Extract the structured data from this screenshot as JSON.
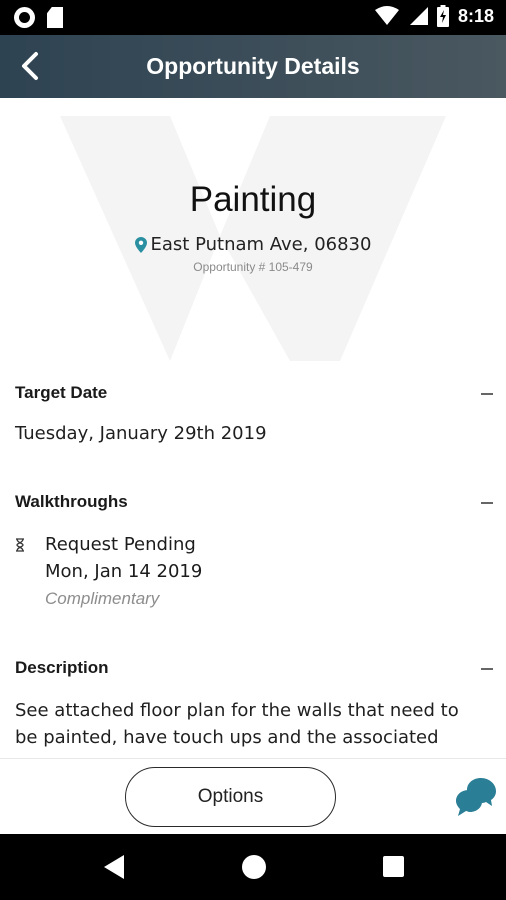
{
  "status_bar": {
    "time": "8:18",
    "icons": [
      "record-icon",
      "sd-card-icon",
      "wifi-icon",
      "signal-icon",
      "battery-charging-icon"
    ]
  },
  "app_bar": {
    "title": "Opportunity Details",
    "back_icon": "chevron-left-icon"
  },
  "hero": {
    "title": "Painting",
    "address": "East Putnam Ave, 06830",
    "opportunity_number": "Opportunity # 105-479",
    "pin_color": "#2a8fa0"
  },
  "sections": {
    "target_date": {
      "title": "Target Date",
      "value": "Tuesday, January 29th 2019"
    },
    "walkthroughs": {
      "title": "Walkthroughs",
      "items": [
        {
          "status": "Request Pending",
          "date": "Mon, Jan 14 2019",
          "type": "Complimentary"
        }
      ]
    },
    "description": {
      "title": "Description",
      "text": "See attached floor plan for the walls that need to be painted, have touch ups and the associated"
    }
  },
  "actions": {
    "options_label": "Options",
    "chat_color": "#2a7e96"
  },
  "nav_bar": {
    "icons": [
      "back-triangle-icon",
      "home-circle-icon",
      "recents-square-icon"
    ]
  }
}
